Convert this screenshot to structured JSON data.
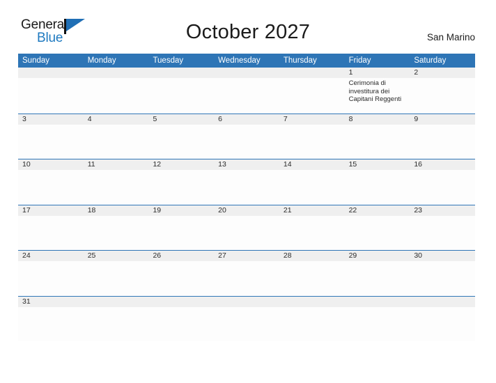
{
  "brand": {
    "name_part1": "General",
    "name_part2": "Blue",
    "color_dark": "#1a1a1a",
    "color_blue": "#1f7ac0"
  },
  "header": {
    "title": "October 2027",
    "locale": "San Marino"
  },
  "theme": {
    "header_blue": "#2e75b6",
    "band_gray": "#efefef",
    "text_dark": "#2b2b2b"
  },
  "weekdays": [
    "Sunday",
    "Monday",
    "Tuesday",
    "Wednesday",
    "Thursday",
    "Friday",
    "Saturday"
  ],
  "weeks": [
    {
      "days": [
        {
          "date": "",
          "event": ""
        },
        {
          "date": "",
          "event": ""
        },
        {
          "date": "",
          "event": ""
        },
        {
          "date": "",
          "event": ""
        },
        {
          "date": "",
          "event": ""
        },
        {
          "date": "1",
          "event": "Cerimonia di investitura dei Capitani Reggenti"
        },
        {
          "date": "2",
          "event": ""
        }
      ]
    },
    {
      "days": [
        {
          "date": "3",
          "event": ""
        },
        {
          "date": "4",
          "event": ""
        },
        {
          "date": "5",
          "event": ""
        },
        {
          "date": "6",
          "event": ""
        },
        {
          "date": "7",
          "event": ""
        },
        {
          "date": "8",
          "event": ""
        },
        {
          "date": "9",
          "event": ""
        }
      ]
    },
    {
      "days": [
        {
          "date": "10",
          "event": ""
        },
        {
          "date": "11",
          "event": ""
        },
        {
          "date": "12",
          "event": ""
        },
        {
          "date": "13",
          "event": ""
        },
        {
          "date": "14",
          "event": ""
        },
        {
          "date": "15",
          "event": ""
        },
        {
          "date": "16",
          "event": ""
        }
      ]
    },
    {
      "days": [
        {
          "date": "17",
          "event": ""
        },
        {
          "date": "18",
          "event": ""
        },
        {
          "date": "19",
          "event": ""
        },
        {
          "date": "20",
          "event": ""
        },
        {
          "date": "21",
          "event": ""
        },
        {
          "date": "22",
          "event": ""
        },
        {
          "date": "23",
          "event": ""
        }
      ]
    },
    {
      "days": [
        {
          "date": "24",
          "event": ""
        },
        {
          "date": "25",
          "event": ""
        },
        {
          "date": "26",
          "event": ""
        },
        {
          "date": "27",
          "event": ""
        },
        {
          "date": "28",
          "event": ""
        },
        {
          "date": "29",
          "event": ""
        },
        {
          "date": "30",
          "event": ""
        }
      ]
    },
    {
      "days": [
        {
          "date": "31",
          "event": ""
        },
        {
          "date": "",
          "event": ""
        },
        {
          "date": "",
          "event": ""
        },
        {
          "date": "",
          "event": ""
        },
        {
          "date": "",
          "event": ""
        },
        {
          "date": "",
          "event": ""
        },
        {
          "date": "",
          "event": ""
        }
      ]
    }
  ]
}
